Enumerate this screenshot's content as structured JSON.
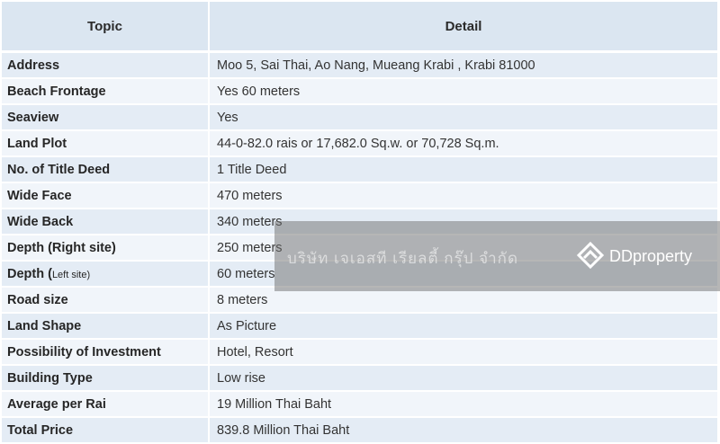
{
  "header": {
    "topic": "Topic",
    "detail": "Detail"
  },
  "rows": [
    {
      "topic": "Address",
      "detail": "Moo 5, Sai Thai, Ao Nang, Mueang Krabi , Krabi 81000"
    },
    {
      "topic": "Beach Frontage",
      "detail": "Yes 60 meters"
    },
    {
      "topic": "Seaview",
      "detail": "Yes"
    },
    {
      "topic": "Land Plot",
      "detail": "44-0-82.0 rais or 17,682.0 Sq.w. or 70,728 Sq.m."
    },
    {
      "topic": "No. of Title Deed",
      "detail": "1 Title Deed"
    },
    {
      "topic": "Wide Face",
      "detail": "470 meters"
    },
    {
      "topic": "Wide Back",
      "detail": "340 meters"
    },
    {
      "topic": "Depth (Right site)",
      "detail": "250 meters"
    },
    {
      "topic_parts": [
        "Depth (",
        "Left site",
        ")"
      ],
      "detail": "60 meters"
    },
    {
      "topic": "Road size",
      "detail": "8 meters"
    },
    {
      "topic": "Land Shape",
      "detail": "As Picture"
    },
    {
      "topic": "Possibility of Investment",
      "detail": "Hotel, Resort"
    },
    {
      "topic": "Building Type",
      "detail": "Low rise"
    },
    {
      "topic": "Average per Rai",
      "detail": "19 Million Thai Baht"
    },
    {
      "topic": "Total Price",
      "detail": "839.8 Million Thai Baht"
    }
  ],
  "watermark": {
    "company": "บริษัท เจเอสที เรียลตี้ กรุ๊ป จำกัด",
    "brand": "DDproperty",
    "logo_icon": "ddproperty-logo-icon"
  },
  "colors": {
    "header_bg": "#dbe6f1",
    "row_odd": "#e4ecf5",
    "row_even": "#f1f5fa"
  }
}
